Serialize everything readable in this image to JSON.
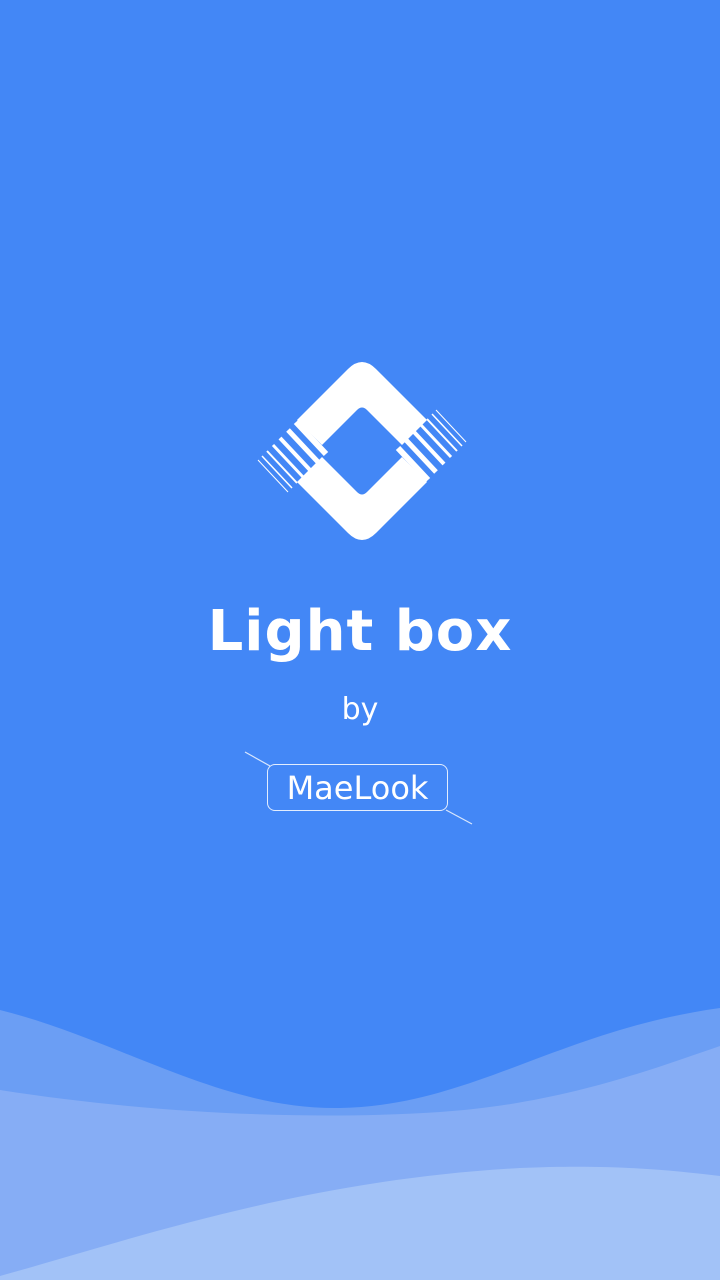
{
  "splash": {
    "app_name": "Light box",
    "by_label": "by",
    "brand": "MaeLook",
    "logo_icon": "lightbox-diamond-logo-icon"
  },
  "colors": {
    "background": "#4387f6",
    "wave_back": "#6b9ef4",
    "wave_mid": "#86adf5",
    "wave_front": "#a2c2f7",
    "foreground": "#ffffff"
  }
}
